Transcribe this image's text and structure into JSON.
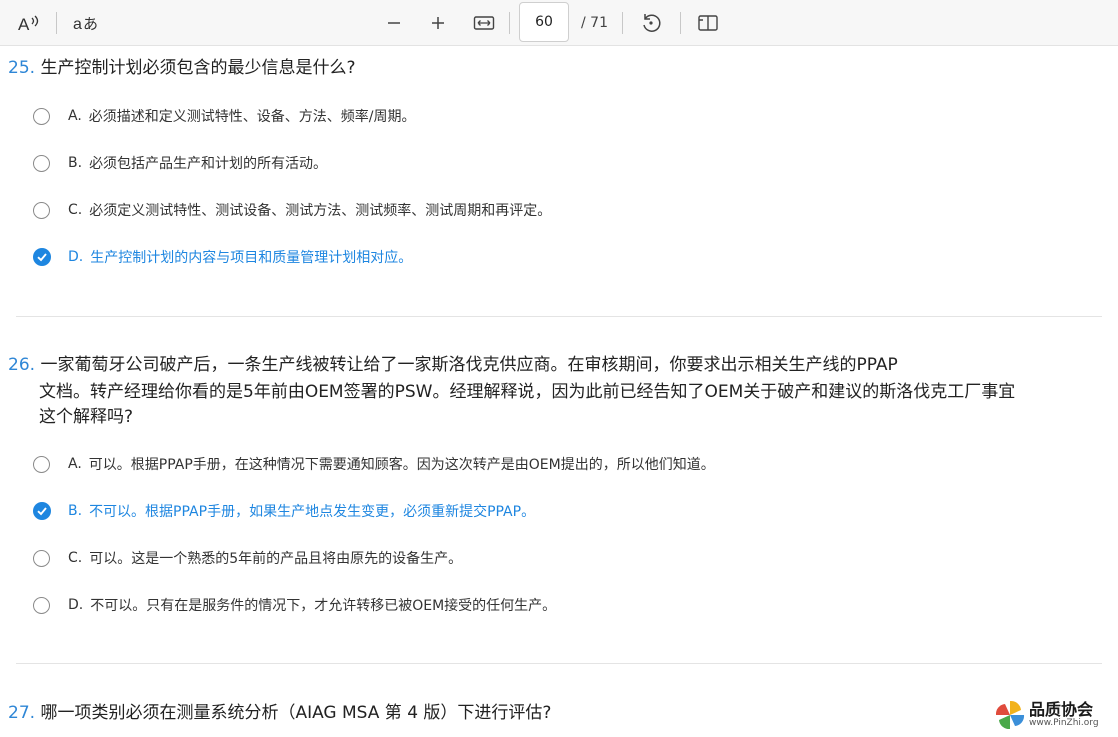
{
  "toolbar": {
    "page_current": "60",
    "page_total": "/ 71",
    "icons": [
      "read-aloud-icon",
      "translate-icon",
      "zoom-out-icon",
      "zoom-in-icon",
      "fit-width-icon",
      "rotate-icon",
      "two-page-view-icon"
    ]
  },
  "questions": [
    {
      "number": "25.",
      "lines": [
        "生产控制计划必须包含的最少信息是什么?"
      ],
      "options": [
        {
          "letter": "A.",
          "text": "必须描述和定义测试特性、设备、方法、频率/周期。",
          "selected": false
        },
        {
          "letter": "B.",
          "text": "必须包括产品生产和计划的所有活动。",
          "selected": false
        },
        {
          "letter": "C.",
          "text": "必须定义测试特性、测试设备、测试方法、测试频率、测试周期和再评定。",
          "selected": false
        },
        {
          "letter": "D.",
          "text": "生产控制计划的内容与项目和质量管理计划相对应。",
          "selected": true
        }
      ]
    },
    {
      "number": "26.",
      "lines": [
        "一家葡萄牙公司破产后，一条生产线被转让给了一家斯洛伐克供应商。在审核期间，你要求出示相关生产线的PPAP",
        "文档。转产经理给你看的是5年前由OEM签署的PSW。经理解释说，因为此前已经告知了OEM关于破产和建议的斯洛伐克工厂事宜",
        "这个解释吗?"
      ],
      "options": [
        {
          "letter": "A.",
          "text": "可以。根据PPAP手册，在这种情况下需要通知顾客。因为这次转产是由OEM提出的，所以他们知道。",
          "selected": false
        },
        {
          "letter": "B.",
          "text": "不可以。根据PPAP手册，如果生产地点发生变更，必须重新提交PPAP。",
          "selected": true
        },
        {
          "letter": "C.",
          "text": "可以。这是一个熟悉的5年前的产品且将由原先的设备生产。",
          "selected": false
        },
        {
          "letter": "D.",
          "text": "不可以。只有在是服务件的情况下，才允许转移已被OEM接受的任何生产。",
          "selected": false
        }
      ]
    },
    {
      "number": "27.",
      "lines": [
        "哪一项类别必须在测量系统分析（AIAG MSA 第 4 版）下进行评估?"
      ],
      "options": []
    }
  ],
  "watermark": {
    "title": "品质协会",
    "url": "www.PinZhi.org"
  },
  "colors": {
    "accent": "#1e86e0",
    "number": "#2e86d6",
    "toolbar_bg": "#f7f7f7"
  }
}
